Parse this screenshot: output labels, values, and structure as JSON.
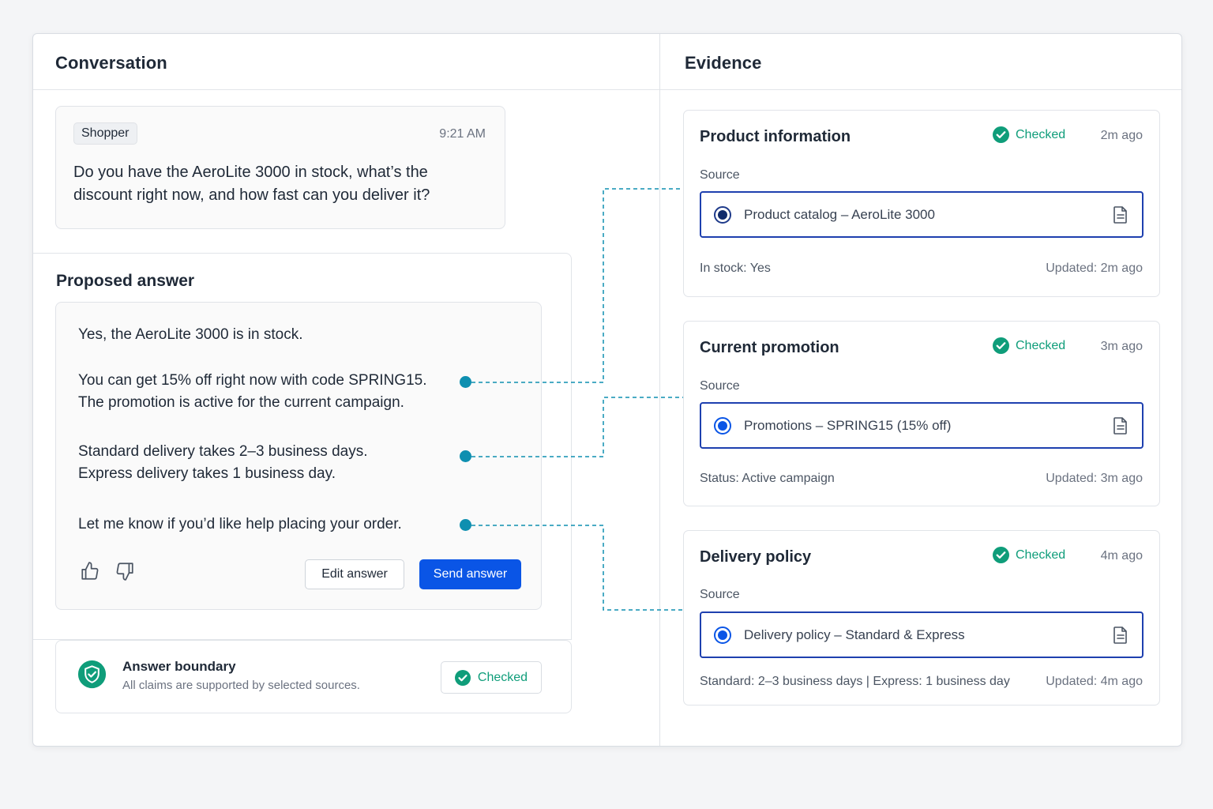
{
  "conversation": {
    "title": "Conversation",
    "message": {
      "sender": "Shopper",
      "time": "9:21 AM",
      "line1": "Do you have the AeroLite 3000 in stock, what’s the",
      "line2": "discount right now, and how fast can you deliver it?"
    }
  },
  "proposed": {
    "title": "Proposed answer",
    "p1": "Yes, the AeroLite 3000 is in stock.",
    "p2_line1": "You can get 15% off right now with code SPRING15.",
    "p2_line2": "The promotion is active for the current campaign.",
    "p3_line1": "Standard delivery takes 2–3 business days.",
    "p3_line2": "Express delivery takes 1 business day.",
    "p4": "Let me know if you’d like help placing your order.",
    "edit_label": "Edit answer",
    "send_label": "Send answer"
  },
  "boundary": {
    "title": "Answer boundary",
    "subtitle": "All claims are supported by selected sources.",
    "status": "Checked"
  },
  "evidence": {
    "title": "Evidence",
    "cards": [
      {
        "title": "Product information",
        "status": "Checked",
        "time": "2m ago",
        "source_label": "Source",
        "source": "Product catalog – AeroLite 3000",
        "detail": "In stock: Yes",
        "updated": "Updated: 2m ago"
      },
      {
        "title": "Current promotion",
        "status": "Checked",
        "time": "3m ago",
        "source_label": "Source",
        "source": "Promotions – SPRING15 (15% off)",
        "detail": "Status: Active campaign",
        "updated": "Updated: 3m ago"
      },
      {
        "title": "Delivery policy",
        "status": "Checked",
        "time": "4m ago",
        "source_label": "Source",
        "source": "Delivery policy – Standard & Express",
        "detail": "Standard: 2–3 business days | Express: 1 business day",
        "updated": "Updated: 4m ago"
      }
    ]
  },
  "colors": {
    "primary": "#0a55e6",
    "checked_green": "#0f9d7a",
    "connector_teal": "#0e8fb0",
    "source_border": "#1e40af"
  }
}
